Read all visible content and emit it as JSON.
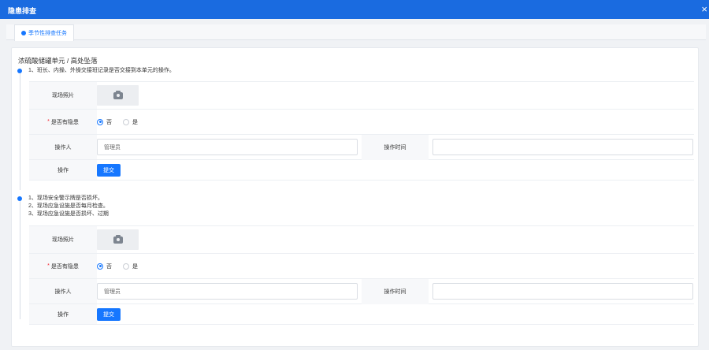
{
  "window": {
    "title": "隐患排查",
    "close_icon": "close-icon"
  },
  "tab": {
    "label": "季节性排查任务",
    "icon": "circle-dot-icon"
  },
  "section": {
    "title": "浓硫酸储罐单元 / 高处坠落"
  },
  "items": [
    {
      "description": [
        "1、班长、内操、外操交接班记录是否交接到本单元的操作。"
      ],
      "photo_label": "现场照片",
      "hazard_label": "是否有隐患",
      "options": [
        "否",
        "是"
      ],
      "selected": "否",
      "operator_label": "操作人",
      "operator_value": "管理员",
      "time_label": "操作时间",
      "time_value": "",
      "action_label": "操作",
      "submit_label": "提交"
    },
    {
      "description": [
        "1、现场安全警示牌是否损坏。",
        "2、现场应急设施是否每月检查。",
        "3、现场应急设施是否损坏、过期"
      ],
      "photo_label": "现场照片",
      "hazard_label": "是否有隐患",
      "options": [
        "否",
        "是"
      ],
      "selected": "否",
      "operator_label": "操作人",
      "operator_value": "管理员",
      "time_label": "操作时间",
      "time_value": "",
      "action_label": "操作",
      "submit_label": "提交"
    }
  ],
  "colors": {
    "titlebar": "#1a6be0",
    "accent": "#1677ff",
    "required": "#f5222d"
  }
}
